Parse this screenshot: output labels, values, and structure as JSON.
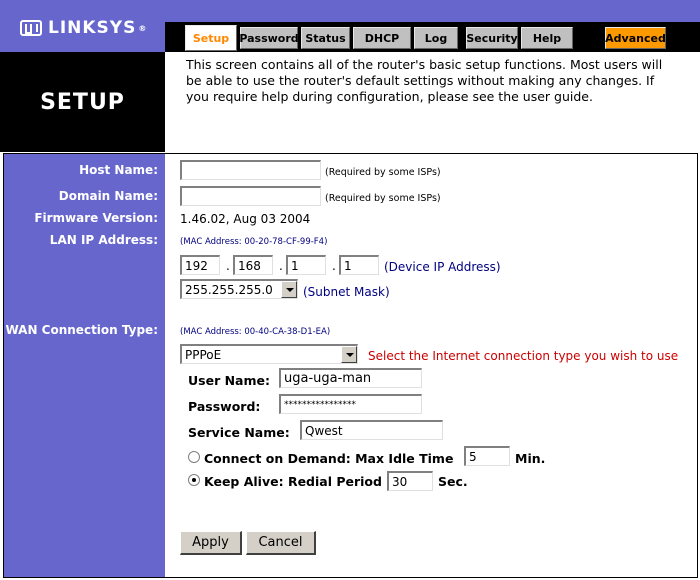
{
  "header": {
    "logo_text": "LINKSYS",
    "logo_reg": "®",
    "tabs": [
      "Setup",
      "Password",
      "Status",
      "DHCP",
      "Log",
      "Security",
      "Help",
      "Advanced"
    ],
    "active_tab": "Setup"
  },
  "section_title": "SETUP",
  "description": "This screen contains all of the router's basic setup functions. Most users will be able to use the router's default settings without making any changes. If you require help during configuration, please see the user guide.",
  "labels": {
    "host_name": "Host Name:",
    "domain_name": "Domain Name:",
    "firmware_version": "Firmware Version:",
    "lan_ip": "LAN IP Address:",
    "wan_type": "WAN Connection Type:"
  },
  "host_name": {
    "value": "",
    "note": "(Required by some ISPs)"
  },
  "domain_name": {
    "value": "",
    "note": "(Required by some ISPs)"
  },
  "firmware": "1.46.02, Aug 03 2004",
  "lan": {
    "mac": "(MAC Address: 00-20-78-CF-99-F4)",
    "ip": [
      "192",
      "168",
      "1",
      "1"
    ],
    "ip_note": "(Device IP Address)",
    "subnet": "255.255.255.0",
    "subnet_note": "(Subnet Mask)"
  },
  "wan": {
    "mac": "(MAC Address: 00-40-CA-38-D1-EA)",
    "type": "PPPoE",
    "type_hint": "Select the Internet connection type you wish to use",
    "user_label": "User Name:",
    "user_value": "uga-uga-man",
    "password_label": "Password:",
    "password_value": "****************",
    "service_label": "Service Name:",
    "service_value": "Qwest",
    "cod_label": "Connect on Demand: Max Idle Time",
    "cod_value": "5",
    "cod_unit": "Min.",
    "keepalive_label": "Keep Alive: Redial Period",
    "keepalive_value": "30",
    "keepalive_unit": "Sec.",
    "selected_mode": "keep_alive"
  },
  "buttons": {
    "apply": "Apply",
    "cancel": "Cancel"
  },
  "colors": {
    "brand": "#6666cc",
    "accent": "#ff9900",
    "hint": "#cc0000"
  }
}
